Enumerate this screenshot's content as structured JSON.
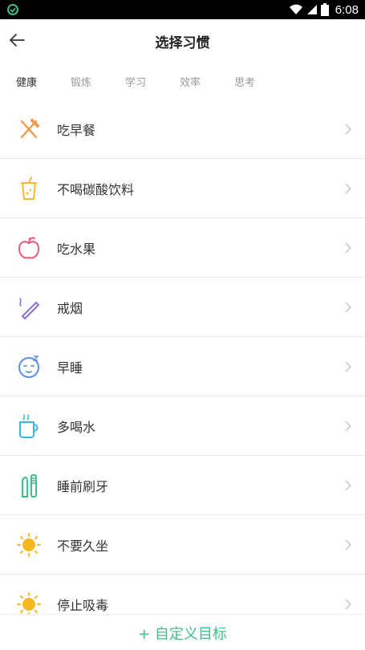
{
  "status_bar": {
    "time": "6:08",
    "icons": [
      "app-notification-icon",
      "wifi-icon",
      "signal-icon",
      "battery-icon"
    ]
  },
  "header": {
    "title": "选择习惯",
    "back_icon": "arrow-left-icon"
  },
  "tabs": [
    {
      "label": "健康",
      "active": true
    },
    {
      "label": "锻炼",
      "active": false
    },
    {
      "label": "学习",
      "active": false
    },
    {
      "label": "效率",
      "active": false
    },
    {
      "label": "思考",
      "active": false
    }
  ],
  "habits": [
    {
      "label": "吃早餐",
      "icon": "fork-knife-icon",
      "color": "#f39a4a"
    },
    {
      "label": "不喝碳酸饮料",
      "icon": "drink-cup-icon",
      "color": "#f5b830"
    },
    {
      "label": "吃水果",
      "icon": "apple-icon",
      "color": "#ef5a7a"
    },
    {
      "label": "戒烟",
      "icon": "cigarette-icon",
      "color": "#8a6fd6"
    },
    {
      "label": "早睡",
      "icon": "sleepy-face-icon",
      "color": "#5b8ee8"
    },
    {
      "label": "多喝水",
      "icon": "mug-icon",
      "color": "#3fb8d8"
    },
    {
      "label": "睡前刷牙",
      "icon": "toothbrush-icon",
      "color": "#3fbf8a"
    },
    {
      "label": "不要久坐",
      "icon": "sun-icon",
      "color": "#f5b820"
    },
    {
      "label": "停止吸毒",
      "icon": "sun-icon",
      "color": "#f5b820"
    }
  ],
  "footer": {
    "add_label": "+ 自定义目标",
    "color": "#3fbf8a"
  }
}
